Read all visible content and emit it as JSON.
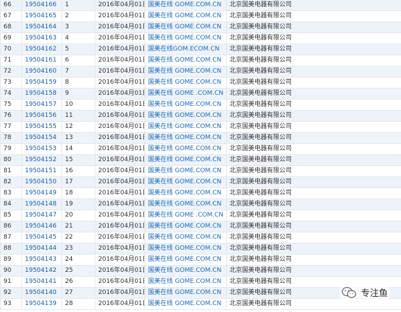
{
  "rows": [
    {
      "idx": "66",
      "reg": "19504166",
      "n": "1",
      "date": "2016年04月01日",
      "site": "国美在线 GOME.COM.CN",
      "company": "北京国美电器有限公司"
    },
    {
      "idx": "67",
      "reg": "19504165",
      "n": "2",
      "date": "2016年04月01日",
      "site": "国美在线 GOME.COM.CN",
      "company": "北京国美电器有限公司"
    },
    {
      "idx": "68",
      "reg": "19504164",
      "n": "3",
      "date": "2016年04月01日",
      "site": "国美在线 GOME.COM.CN",
      "company": "北京国美电器有限公司"
    },
    {
      "idx": "69",
      "reg": "19504163",
      "n": "4",
      "date": "2016年04月01日",
      "site": "国美在线 GOME.COM.CN",
      "company": "北京国美电器有限公司"
    },
    {
      "idx": "70",
      "reg": "19504162",
      "n": "5",
      "date": "2016年04月01日",
      "site": "国美在线GOM.ECOM.CN",
      "company": "北京国美电器有限公司"
    },
    {
      "idx": "71",
      "reg": "19504161",
      "n": "6",
      "date": "2016年04月01日",
      "site": "国美在线 GOME.COM.CN",
      "company": "北京国美电器有限公司"
    },
    {
      "idx": "72",
      "reg": "19504160",
      "n": "7",
      "date": "2016年04月01日",
      "site": "国美在线 GOME.COM.CN",
      "company": "北京国美电器有限公司"
    },
    {
      "idx": "73",
      "reg": "19504159",
      "n": "8",
      "date": "2016年04月01日",
      "site": "国美在线 GOME.COM.CN",
      "company": "北京国美电器有限公司"
    },
    {
      "idx": "74",
      "reg": "19504158",
      "n": "9",
      "date": "2016年04月01日",
      "site": "国美在线 GOME .COM.CN",
      "company": "北京国美电器有限公司"
    },
    {
      "idx": "75",
      "reg": "19504157",
      "n": "10",
      "date": "2016年04月01日",
      "site": "国美在线 GOME.COM.CN",
      "company": "北京国美电器有限公司"
    },
    {
      "idx": "76",
      "reg": "19504156",
      "n": "11",
      "date": "2016年04月01日",
      "site": "国美在线 GOME.COM.CN",
      "company": "北京国美电器有限公司"
    },
    {
      "idx": "77",
      "reg": "19504155",
      "n": "12",
      "date": "2016年04月01日",
      "site": "国美在线 GOME.COM.CN",
      "company": "北京国美电器有限公司"
    },
    {
      "idx": "78",
      "reg": "19504154",
      "n": "13",
      "date": "2016年04月01日",
      "site": "国美在线 GOME.COM.CN",
      "company": "北京国美电器有限公司"
    },
    {
      "idx": "79",
      "reg": "19504153",
      "n": "14",
      "date": "2016年04月01日",
      "site": "国美在线 GOME.COM.CN",
      "company": "北京国美电器有限公司"
    },
    {
      "idx": "80",
      "reg": "19504152",
      "n": "15",
      "date": "2016年04月01日",
      "site": "国美在线 GOME.COM.CN",
      "company": "北京国美电器有限公司"
    },
    {
      "idx": "81",
      "reg": "19504151",
      "n": "16",
      "date": "2016年04月01日",
      "site": "国美在线 GOME.COM.CN",
      "company": "北京国美电器有限公司"
    },
    {
      "idx": "82",
      "reg": "19504150",
      "n": "17",
      "date": "2016年04月01日",
      "site": "国美在线 GOME.COM.CN",
      "company": "北京国美电器有限公司"
    },
    {
      "idx": "83",
      "reg": "19504149",
      "n": "18",
      "date": "2016年04月01日",
      "site": "国美在线 GOME.COM.CN",
      "company": "北京国美电器有限公司"
    },
    {
      "idx": "84",
      "reg": "19504148",
      "n": "19",
      "date": "2016年04月01日",
      "site": "国美在线 GOME.COM.CN",
      "company": "北京国美电器有限公司"
    },
    {
      "idx": "85",
      "reg": "19504147",
      "n": "20",
      "date": "2016年04月01日",
      "site": "国美在线 GOME .COM.CN",
      "company": "北京国美电器有限公司"
    },
    {
      "idx": "86",
      "reg": "19504146",
      "n": "21",
      "date": "2016年04月01日",
      "site": "国美在线 GOME.COM.CN",
      "company": "北京国美电器有限公司"
    },
    {
      "idx": "87",
      "reg": "19504145",
      "n": "22",
      "date": "2016年04月01日",
      "site": "国美在线 GOME.COM.CN",
      "company": "北京国美电器有限公司"
    },
    {
      "idx": "88",
      "reg": "19504144",
      "n": "23",
      "date": "2016年04月01日",
      "site": "国美在线 GOME.COM.CN",
      "company": "北京国美电器有限公司"
    },
    {
      "idx": "89",
      "reg": "19504143",
      "n": "24",
      "date": "2016年04月01日",
      "site": "国美在线 GOME.COM.CN",
      "company": "北京国美电器有限公司"
    },
    {
      "idx": "90",
      "reg": "19504142",
      "n": "25",
      "date": "2016年04月01日",
      "site": "国美在线 GOME.COM.CN",
      "company": "北京国美电器有限公司"
    },
    {
      "idx": "91",
      "reg": "19504141",
      "n": "26",
      "date": "2016年04月01日",
      "site": "国美在线 GOME.COM.CN",
      "company": "北京国美电器有限公司"
    },
    {
      "idx": "92",
      "reg": "19504140",
      "n": "27",
      "date": "2016年04月01日",
      "site": "国美在线 GOME.COM.CN",
      "company": "北京国美电器有限公司"
    },
    {
      "idx": "93",
      "reg": "19504139",
      "n": "28",
      "date": "2016年04月01日",
      "site": "国美在线 GOME.COM.CN",
      "company": "北京国美电器有限公司"
    }
  ],
  "watermark": {
    "text": "专注鱼",
    "icon": "wechat-icon"
  },
  "colors": {
    "row_stripe": "#eef3fa",
    "link_blue": "#1a5fa8",
    "grid_line": "#e2e7ee"
  }
}
